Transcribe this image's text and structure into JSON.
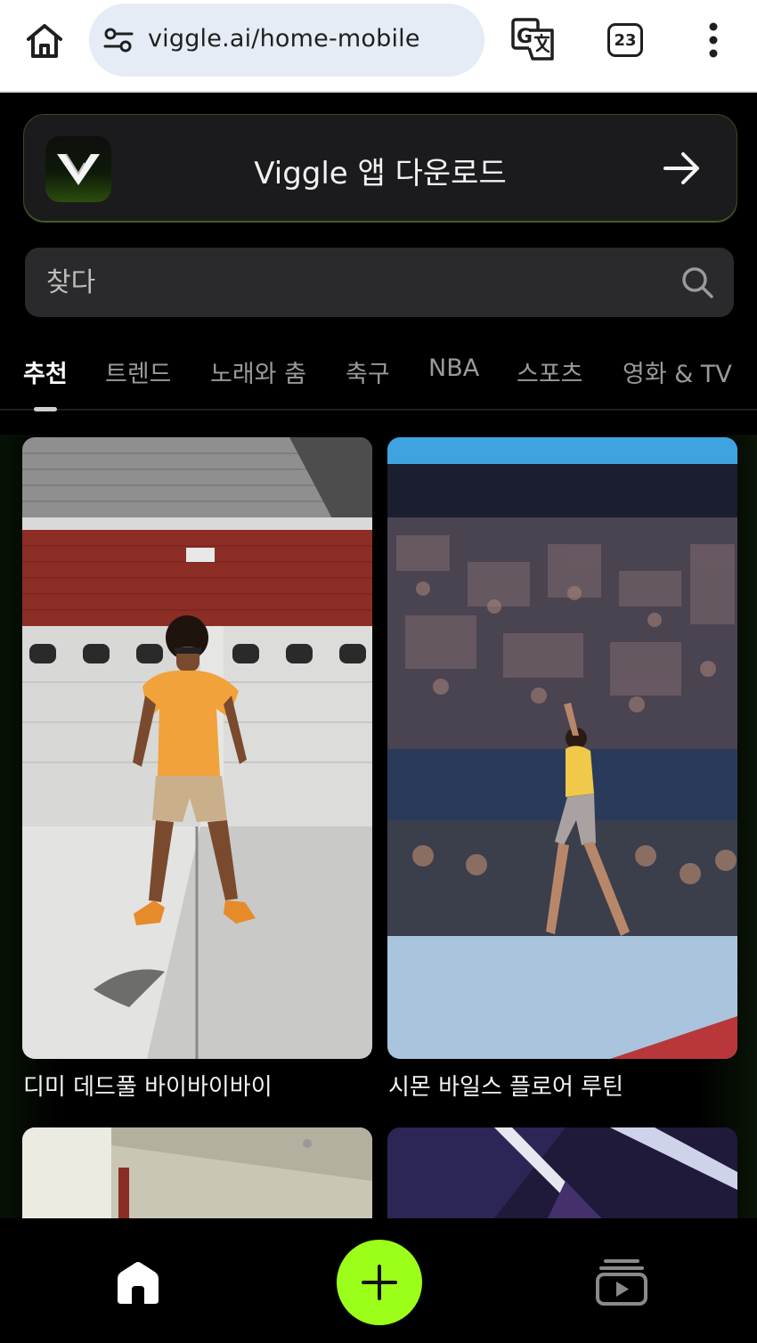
{
  "browser": {
    "url": "viggle.ai/home-mobile",
    "tab_count": "23"
  },
  "banner": {
    "text": "Viggle 앱 다운로드"
  },
  "search": {
    "placeholder": "찾다"
  },
  "tabs": [
    {
      "label": "추천",
      "active": true
    },
    {
      "label": "트렌드",
      "active": false
    },
    {
      "label": "노래와 춤",
      "active": false
    },
    {
      "label": "축구",
      "active": false
    },
    {
      "label": "NBA",
      "active": false
    },
    {
      "label": "스포츠",
      "active": false
    },
    {
      "label": "영화 & TV",
      "active": false
    }
  ],
  "feed": {
    "cards": [
      {
        "title": "디미 데드풀 바이바이바이"
      },
      {
        "title": "시몬 바일스 플로어 루틴"
      }
    ]
  },
  "colors": {
    "accent": "#9bff1a",
    "background": "#000000"
  },
  "icons": {
    "browser_home": "home-icon",
    "site_settings": "tune-icon",
    "translate": "translate-icon",
    "more": "more-vert-icon",
    "search": "search-icon",
    "arrow": "arrow-right-icon",
    "nav_home": "home-filled-icon",
    "nav_create": "plus-icon",
    "nav_library": "video-library-icon"
  }
}
